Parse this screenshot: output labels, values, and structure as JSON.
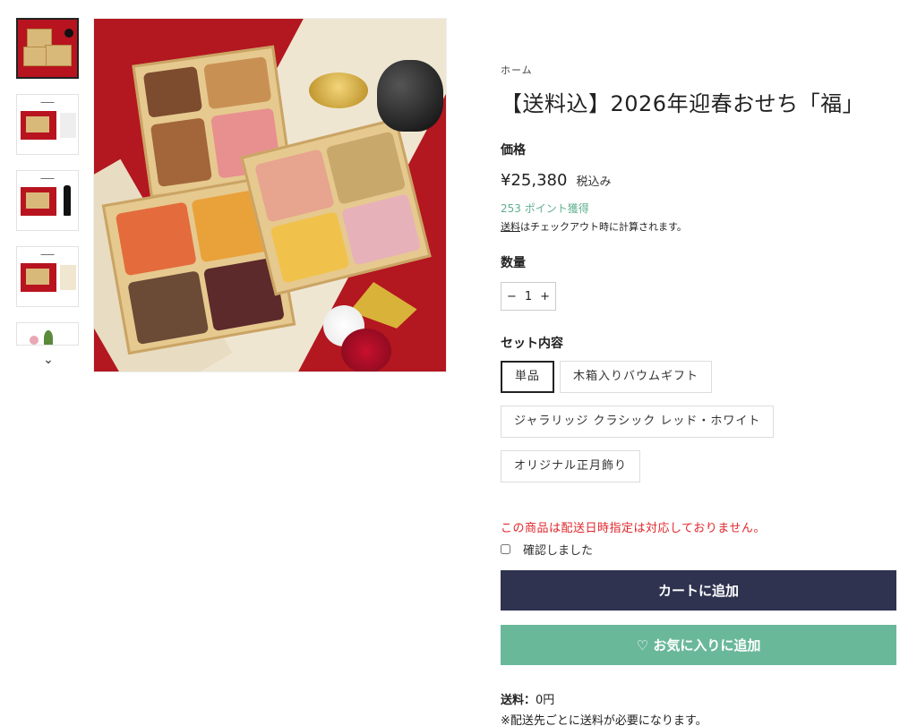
{
  "breadcrumb": "ホーム",
  "product": {
    "title": "【送料込】2026年迎春おせち「福」",
    "price_label": "価格",
    "price": "¥25,380",
    "tax_note": "税込み",
    "points": "253 ポイント獲得",
    "shipping_link": "送料",
    "shipping_note": "はチェックアウト時に計算されます。"
  },
  "quantity": {
    "label": "数量",
    "minus": "−",
    "value": "1",
    "plus": "+"
  },
  "set": {
    "label": "セット内容",
    "options": [
      "単品",
      "木箱入りバウムギフト",
      "ジャラリッジ クラシック レッド・ホワイト",
      "オリジナル正月飾り"
    ],
    "selected_index": 0
  },
  "warning": "この商品は配送日時指定は対応しておりません。",
  "confirm_label": "確認しました",
  "buttons": {
    "add_to_cart": "カートに追加",
    "add_to_favorites": "♡ お気に入りに追加"
  },
  "shipping": {
    "label": "送料：",
    "value": "0円",
    "note": "※配送先ごとに送料が必要になります。"
  },
  "thumbnails": {
    "next_icon": "⌄"
  },
  "colors": {
    "cart_button": "#2f3350",
    "favorite_button": "#6ab89a",
    "warning": "#e0262b",
    "points": "#5fb08f"
  }
}
